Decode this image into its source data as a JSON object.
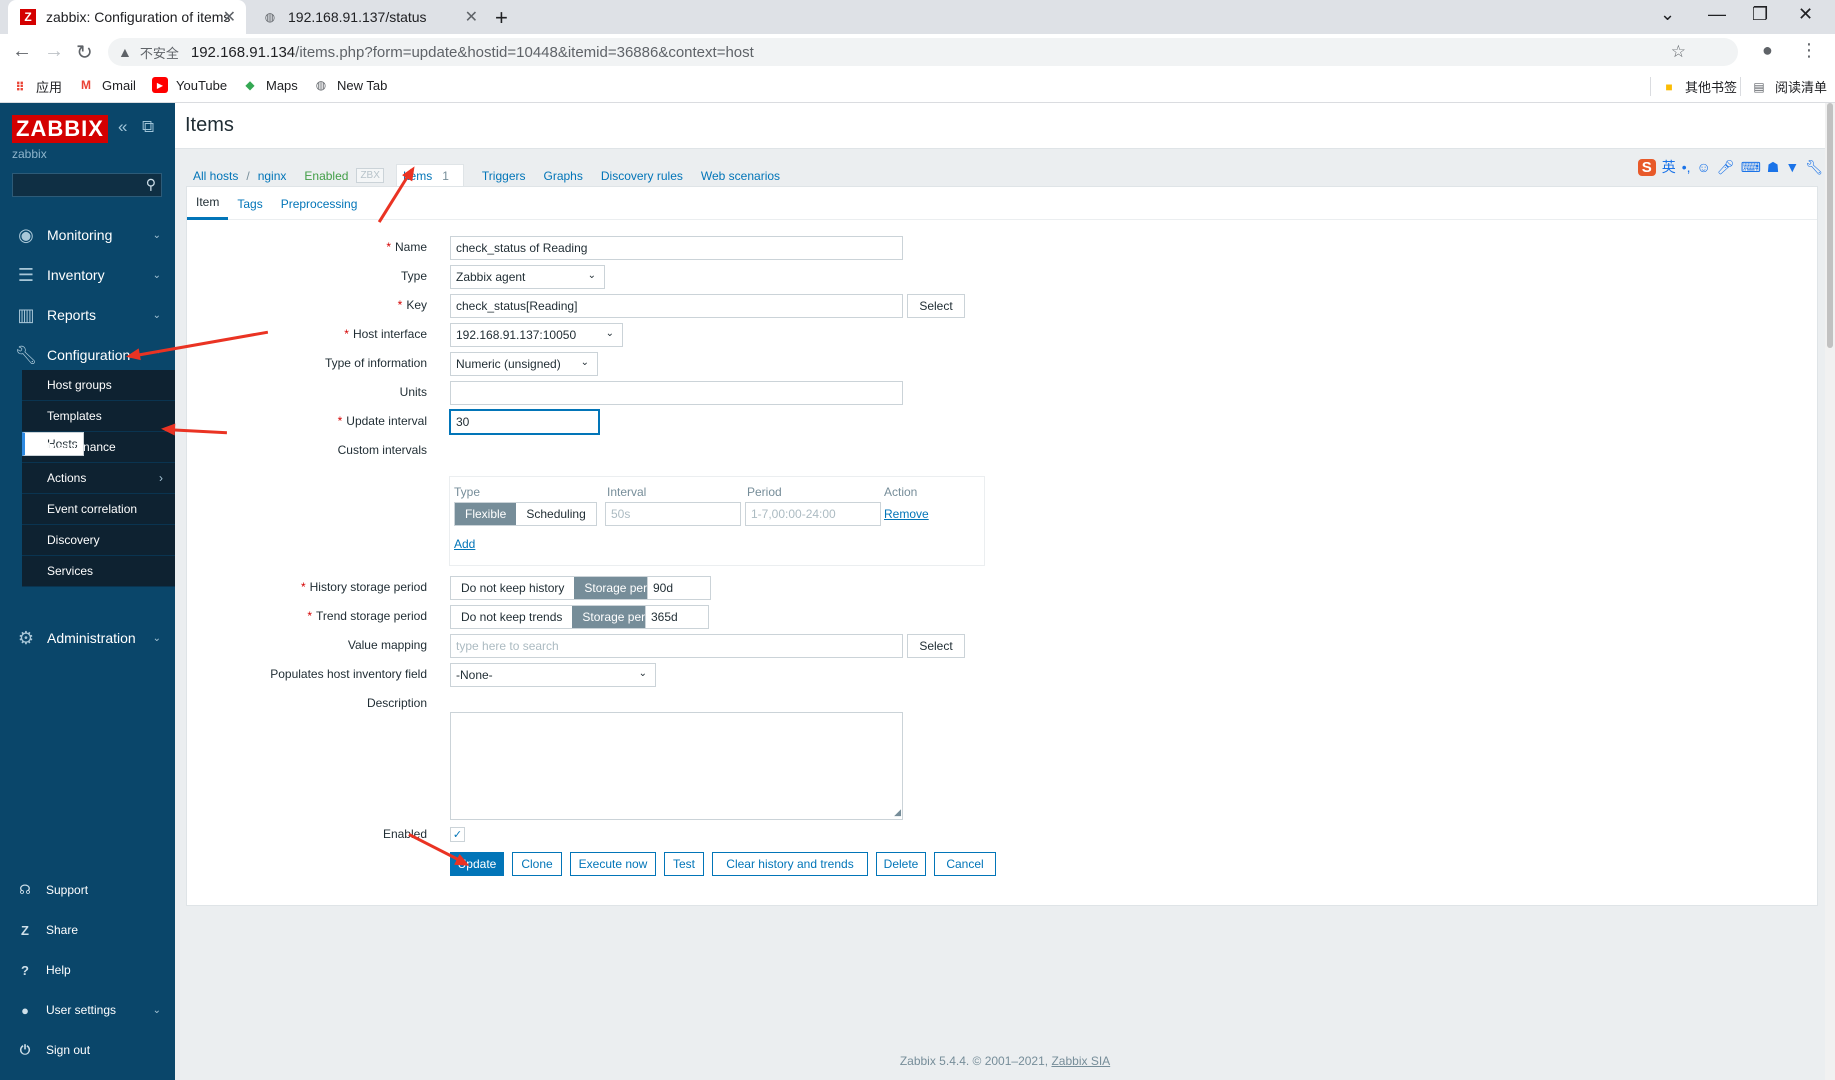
{
  "browser": {
    "tabs": [
      {
        "title": "zabbix: Configuration of items",
        "active": true
      },
      {
        "title": "192.168.91.137/status",
        "active": false
      }
    ],
    "security_label": "不安全",
    "url_host": "192.168.91.134",
    "url_path": "/items.php?form=update&hostid=10448&itemid=36886&context=host",
    "bookmarks": [
      "应用",
      "Gmail",
      "YouTube",
      "Maps",
      "New Tab"
    ],
    "bookmarks_right": [
      "其他书签",
      "阅读清单"
    ]
  },
  "sidebar": {
    "logo": "ZABBIX",
    "server_name": "zabbix",
    "menu": [
      {
        "label": "Monitoring",
        "icon": "eye-icon"
      },
      {
        "label": "Inventory",
        "icon": "list-icon"
      },
      {
        "label": "Reports",
        "icon": "chart-icon"
      },
      {
        "label": "Configuration",
        "icon": "wrench-icon"
      },
      {
        "label": "Administration",
        "icon": "gear-icon"
      }
    ],
    "submenu": [
      "Host groups",
      "Templates",
      "Hosts",
      "Maintenance",
      "Actions",
      "Event correlation",
      "Discovery",
      "Services"
    ],
    "submenu_selected": "Hosts",
    "bottom": [
      {
        "label": "Support",
        "icon": "headset-icon"
      },
      {
        "label": "Share",
        "icon": "share-icon"
      },
      {
        "label": "Help",
        "icon": "help-icon"
      },
      {
        "label": "User settings",
        "icon": "user-icon"
      },
      {
        "label": "Sign out",
        "icon": "power-icon"
      }
    ]
  },
  "page": {
    "title": "Items",
    "breadcrumb": {
      "all_hosts": "All hosts",
      "sep": "/",
      "host": "nginx",
      "status": "Enabled",
      "zbx": "ZBX",
      "items": "Items",
      "items_count": "1",
      "triggers": "Triggers",
      "graphs": "Graphs",
      "discovery": "Discovery rules",
      "web": "Web scenarios"
    },
    "ime_label": "英"
  },
  "form": {
    "tabs": [
      "Item",
      "Tags",
      "Preprocessing"
    ],
    "name_label": "Name",
    "name_value": "check_status of Reading",
    "type_label": "Type",
    "type_value": "Zabbix agent",
    "key_label": "Key",
    "key_value": "check_status[Reading]",
    "select_label": "Select",
    "host_interface_label": "Host interface",
    "host_interface_value": "192.168.91.137:10050",
    "type_info_label": "Type of information",
    "type_info_value": "Numeric (unsigned)",
    "units_label": "Units",
    "units_value": "",
    "update_interval_label": "Update interval",
    "update_interval_value": "30",
    "custom_intervals_label": "Custom intervals",
    "custom_intervals": {
      "headers": [
        "Type",
        "Interval",
        "Period",
        "Action"
      ],
      "type_options": [
        "Flexible",
        "Scheduling"
      ],
      "type_selected": "Flexible",
      "interval_placeholder": "50s",
      "period_placeholder": "1-7,00:00-24:00",
      "remove_label": "Remove",
      "add_label": "Add"
    },
    "history_label": "History storage period",
    "history_options": [
      "Do not keep history",
      "Storage period"
    ],
    "history_value": "90d",
    "trend_label": "Trend storage period",
    "trend_options": [
      "Do not keep trends",
      "Storage period"
    ],
    "trend_value": "365d",
    "value_mapping_label": "Value mapping",
    "value_mapping_placeholder": "type here to search",
    "inventory_label": "Populates host inventory field",
    "inventory_value": "-None-",
    "description_label": "Description",
    "description_value": "",
    "enabled_label": "Enabled",
    "enabled_checked": true,
    "buttons": {
      "update": "Update",
      "clone": "Clone",
      "execute": "Execute now",
      "test": "Test",
      "clear": "Clear history and trends",
      "delete": "Delete",
      "cancel": "Cancel"
    }
  },
  "footer": {
    "text": "Zabbix 5.4.4. © 2001–2021,",
    "link": "Zabbix SIA"
  },
  "colors": {
    "sidebar_bg": "#0a466a",
    "accent": "#0275b8",
    "logo_red": "#d40000",
    "annotation_arrow": "#ea3323"
  }
}
